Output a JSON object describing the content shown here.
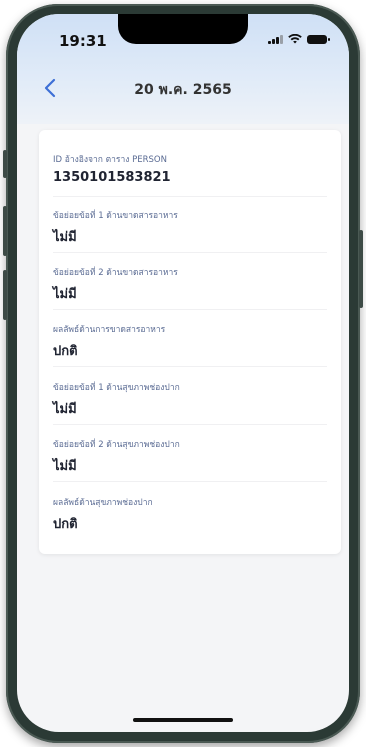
{
  "status_bar": {
    "time": "19:31"
  },
  "nav": {
    "back_icon": "chevron-left-icon",
    "title": "20 พ.ค. 2565"
  },
  "fields": [
    {
      "label": "ID อ้างอิงจาก ตาราง PERSON",
      "value": "1350101583821"
    },
    {
      "label": "ข้อย่อยข้อที่ 1 ด้านขาดสารอาหาร",
      "value": "ไม่มี"
    },
    {
      "label": "ข้อย่อยข้อที่ 2 ด้านขาดสารอาหาร",
      "value": "ไม่มี"
    },
    {
      "label": "ผลลัพธ์ด้านการขาดสารอาหาร",
      "value": "ปกติ"
    },
    {
      "label": "ข้อย่อยข้อที่ 1 ด้านสุขภาพช่องปาก",
      "value": "ไม่มี"
    },
    {
      "label": "ข้อย่อยข้อที่ 2 ด้านสุขภาพช่องปาก",
      "value": "ไม่มี"
    },
    {
      "label": "ผลลัพธ์ด้านสุขภาพช่องปาก",
      "value": "ปกติ"
    }
  ],
  "colors": {
    "accent": "#3d6fd6",
    "label": "#5a6b93",
    "value": "#202432",
    "header_gradient_top": "#cfe0f6"
  }
}
